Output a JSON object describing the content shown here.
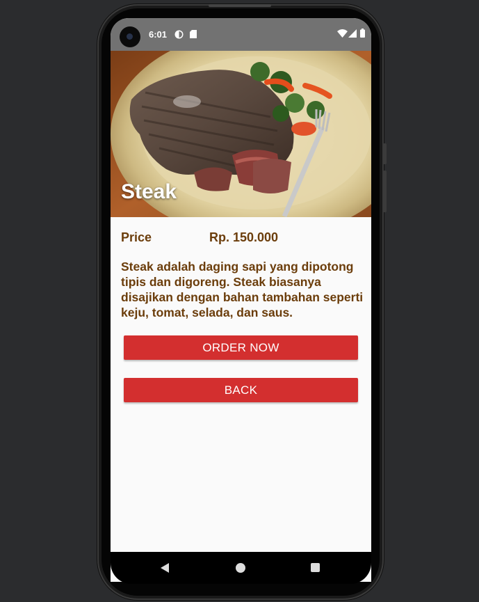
{
  "status_bar": {
    "time": "6:01",
    "icons": [
      "data-saver-icon",
      "sd-card-icon",
      "wifi-icon",
      "signal-icon",
      "battery-icon"
    ]
  },
  "hero": {
    "title": "Steak",
    "image": "steak-plate-image"
  },
  "details": {
    "price_label": "Price",
    "price_value": "Rp. 150.000",
    "description": "Steak adalah daging sapi yang dipotong tipis dan digoreng. Steak biasanya disajikan dengan bahan tambahan seperti keju, tomat, selada, dan saus."
  },
  "buttons": {
    "order_label": "ORDER NOW",
    "back_label": "BACK"
  },
  "navigation": {
    "icons": [
      "back-icon",
      "home-icon",
      "recents-icon"
    ]
  },
  "colors": {
    "accent": "#d32f2f",
    "text_brown": "#6b3d0b",
    "status_bar": "#727272"
  }
}
